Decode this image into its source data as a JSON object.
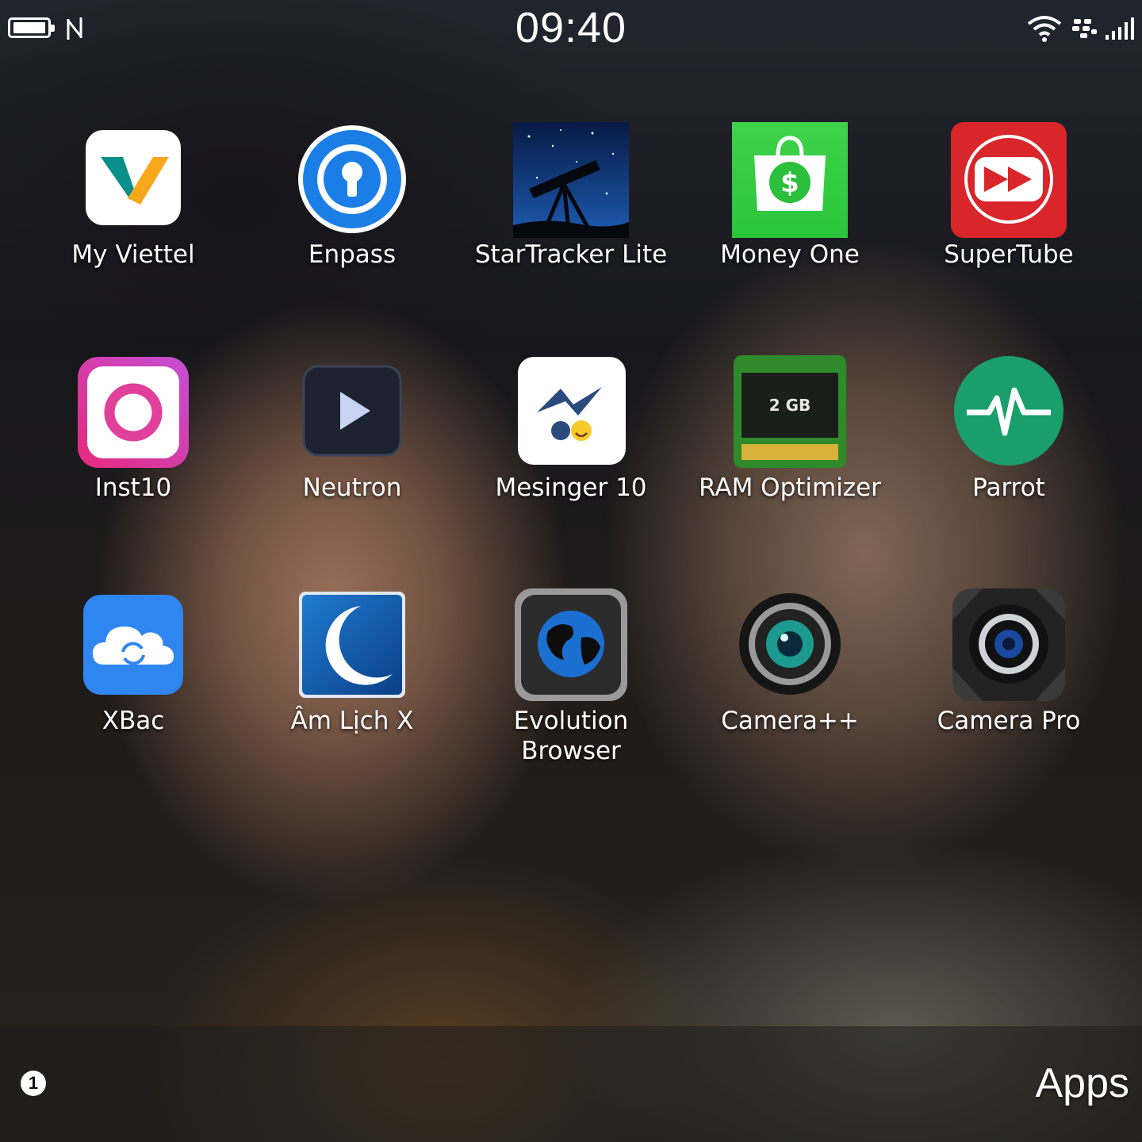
{
  "status": {
    "time": "09:40",
    "battery_icon": "battery-icon",
    "nfc_icon": "nfc-icon",
    "wifi_icon": "wifi-icon",
    "bbm_icon": "blackberry-icon",
    "signal_icon": "signal-icon"
  },
  "apps": [
    {
      "label": "My Viettel"
    },
    {
      "label": "Enpass"
    },
    {
      "label": "StarTracker Lite"
    },
    {
      "label": "Money One"
    },
    {
      "label": "SuperTube"
    },
    {
      "label": "Inst10"
    },
    {
      "label": "Neutron"
    },
    {
      "label": "Mesinger 10"
    },
    {
      "label": "RAM Optimizer",
      "chip_text": "2 GB"
    },
    {
      "label": "Parrot"
    },
    {
      "label": "XBac"
    },
    {
      "label": "Âm Lịch X"
    },
    {
      "label": "Evolution Browser"
    },
    {
      "label": "Camera++"
    },
    {
      "label": "Camera Pro"
    }
  ],
  "bottom": {
    "page_badge": "1",
    "title": "Apps"
  }
}
